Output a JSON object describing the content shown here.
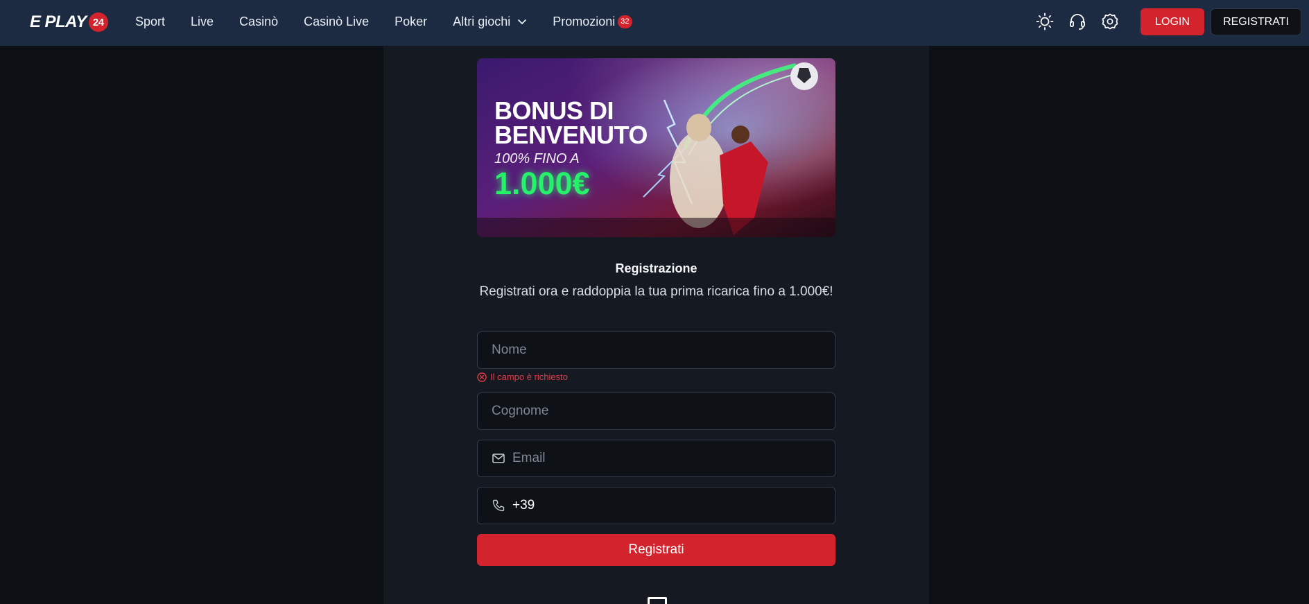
{
  "header": {
    "logo": {
      "letter": "E",
      "text": "PLAY",
      "badge": "24"
    },
    "nav": [
      {
        "label": "Sport"
      },
      {
        "label": "Live"
      },
      {
        "label": "Casinò"
      },
      {
        "label": "Casinò Live"
      },
      {
        "label": "Poker"
      },
      {
        "label": "Altri giochi"
      },
      {
        "label": "Promozioni",
        "count": "32"
      }
    ],
    "icons": [
      "sun-icon",
      "headset-icon",
      "settings-gear-icon"
    ],
    "login_label": "LOGIN",
    "register_label": "REGISTRATI"
  },
  "banner": {
    "title": "BONUS DI BENVENUTO",
    "subtitle": "100% FINO A",
    "amount": "1.000€"
  },
  "registration": {
    "title": "Registrazione",
    "subtitle": "Registrati ora e raddoppia la tua prima ricarica fino a 1.000€!",
    "fields": {
      "nome": {
        "placeholder": "Nome",
        "value": ""
      },
      "nome_error": "Il campo è richiesto",
      "cognome": {
        "placeholder": "Cognome",
        "value": ""
      },
      "email": {
        "placeholder": "Email",
        "value": ""
      },
      "phone": {
        "value": "+39"
      }
    },
    "submit_label": "Registrati"
  },
  "colors": {
    "header_bg": "#1c2b42",
    "page_bg": "#0c0f14",
    "panel_bg": "#151a22",
    "accent_red": "#d3242e",
    "error_red": "#e23a44",
    "banner_amount_green": "#27f06a"
  }
}
